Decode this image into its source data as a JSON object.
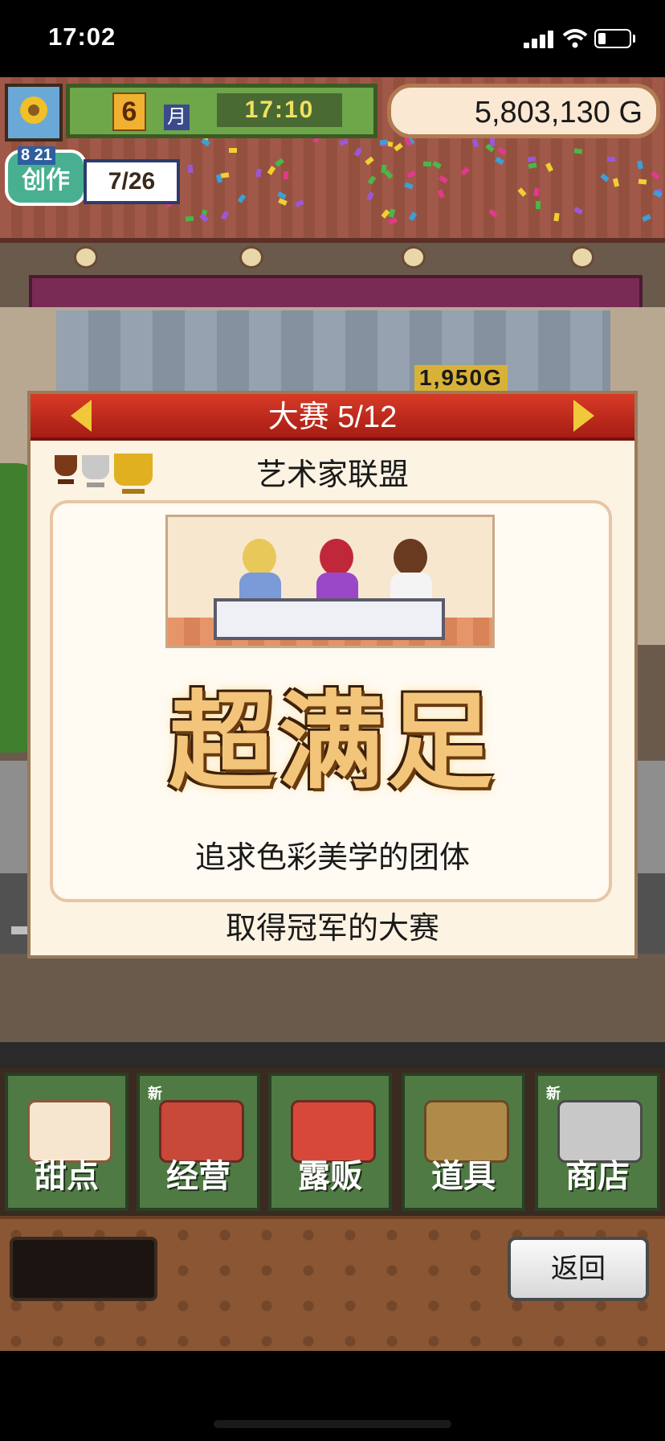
{
  "status_bar": {
    "time": "17:02",
    "signal_bars": 4,
    "wifi": "wifi-icon",
    "battery_level": 0.25
  },
  "hud": {
    "season_icon": "sunflower-icon",
    "month": "6",
    "month_label": "月",
    "clock": "17:10",
    "money": "5,803,130 G",
    "create_label": "创作",
    "create_date": "8 21",
    "create_progress": "7/26",
    "shop_sign": "1,950G"
  },
  "dialog": {
    "title": "大赛 5/12",
    "prev_icon": "arrow-left-icon",
    "next_icon": "arrow-right-icon",
    "league_name": "艺术家联盟",
    "rating": "超满足",
    "team_description": "追求色彩美学的团体",
    "contest_note": "取得冠军的大赛",
    "trophies": [
      "bronze-trophy-icon",
      "silver-trophy-icon",
      "gold-trophy-icon"
    ]
  },
  "menu": {
    "items": [
      {
        "label": "甜点",
        "icon": "cake-icon",
        "new": ""
      },
      {
        "label": "经营",
        "icon": "shop-icon",
        "new": "新"
      },
      {
        "label": "露贩",
        "icon": "food-truck-icon",
        "new": ""
      },
      {
        "label": "道具",
        "icon": "gear-bag-icon",
        "new": ""
      },
      {
        "label": "商店",
        "icon": "shopping-cart-icon",
        "new": "新"
      }
    ]
  },
  "footer": {
    "back_label": "返回"
  },
  "colors": {
    "header_red": "#c0281c",
    "menu_green": "#4f7a44",
    "rating_gold": "#f3c57a"
  }
}
